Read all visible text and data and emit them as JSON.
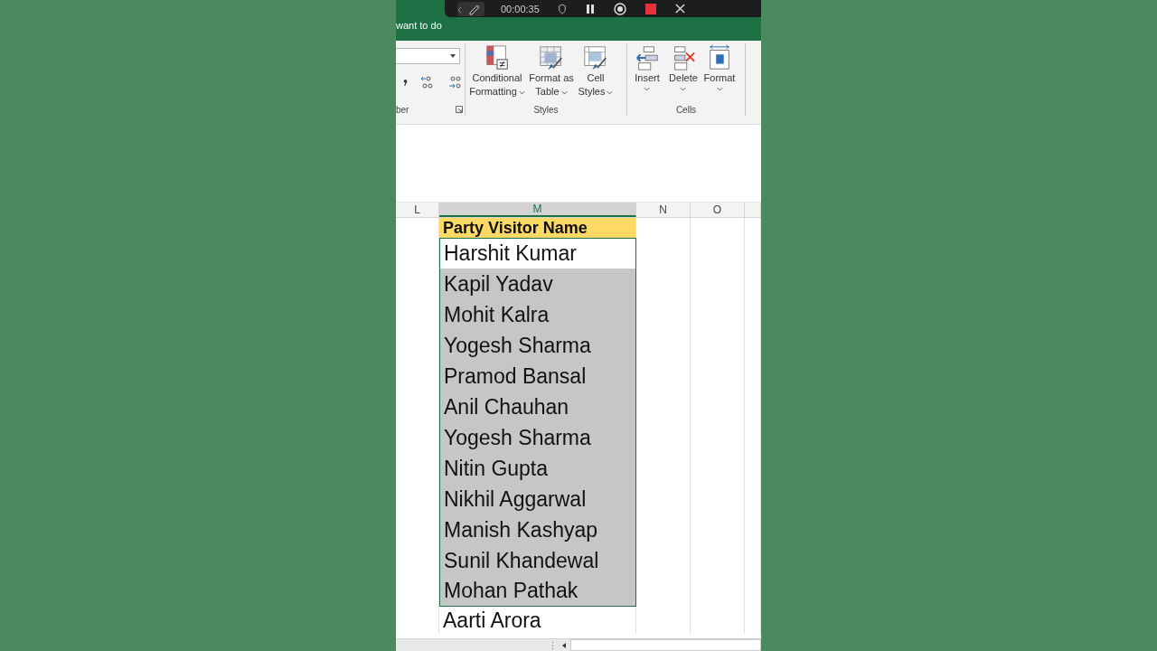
{
  "recorder": {
    "time": "00:00:35"
  },
  "tell_me": "want to do",
  "ribbon": {
    "groups": [
      {
        "kind": "number",
        "label": "ber"
      },
      {
        "kind": "styles",
        "label": "Styles",
        "commands": [
          {
            "label": "Conditional Formatting"
          },
          {
            "label": "Format as Table"
          },
          {
            "label": "Cell Styles"
          }
        ]
      },
      {
        "kind": "cells",
        "label": "Cells",
        "commands": [
          {
            "label": "Insert"
          },
          {
            "label": "Delete"
          },
          {
            "label": "Format"
          }
        ]
      }
    ]
  },
  "columns": [
    {
      "label": "L",
      "selected": false
    },
    {
      "label": "M",
      "selected": true
    },
    {
      "label": "N",
      "selected": false
    },
    {
      "label": "O",
      "selected": false
    }
  ],
  "rows": [
    {
      "kind": "header",
      "text": "Party Visitor Name",
      "selected": false,
      "active": false
    },
    {
      "kind": "name",
      "text": "Harshit Kumar",
      "selected": true,
      "active": true
    },
    {
      "kind": "name",
      "text": "Kapil Yadav",
      "selected": true,
      "active": false
    },
    {
      "kind": "name",
      "text": "Mohit Kalra",
      "selected": true,
      "active": false
    },
    {
      "kind": "name",
      "text": "Yogesh Sharma",
      "selected": true,
      "active": false
    },
    {
      "kind": "name",
      "text": "Pramod Bansal",
      "selected": true,
      "active": false
    },
    {
      "kind": "name",
      "text": "Anil Chauhan",
      "selected": true,
      "active": false
    },
    {
      "kind": "name",
      "text": "Yogesh Sharma",
      "selected": true,
      "active": false
    },
    {
      "kind": "name",
      "text": "Nitin Gupta",
      "selected": true,
      "active": false
    },
    {
      "kind": "name",
      "text": "Nikhil Aggarwal",
      "selected": true,
      "active": false
    },
    {
      "kind": "name",
      "text": "Manish Kashyap",
      "selected": true,
      "active": false
    },
    {
      "kind": "name",
      "text": "Sunil Khandewal",
      "selected": true,
      "active": false
    },
    {
      "kind": "name",
      "text": "Mohan Pathak",
      "selected": true,
      "active": false
    },
    {
      "kind": "cut",
      "text": "Aarti Arora",
      "selected": false,
      "active": false
    }
  ]
}
